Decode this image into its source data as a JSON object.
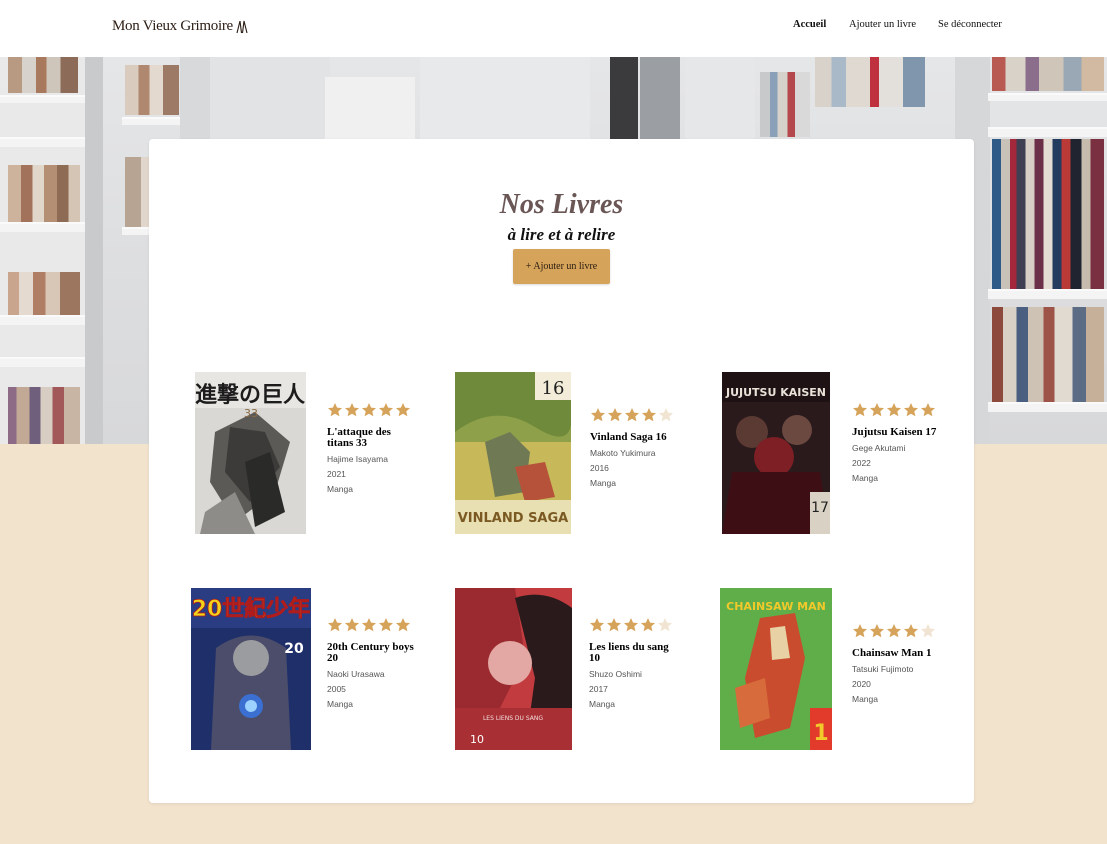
{
  "header": {
    "logo_text": "Mon Vieux Grimoire",
    "nav": {
      "home": "Accueil",
      "add_book": "Ajouter un livre",
      "logout": "Se déconnecter"
    }
  },
  "main": {
    "title": "Nos Livres",
    "subtitle": "à lire et à relire",
    "add_button": "+ Ajouter un livre"
  },
  "colors": {
    "accent": "#d6a35a",
    "star_filled": "#d6a35a",
    "star_empty": "#f1e4d2",
    "page_bg": "#f2e3cd",
    "title": "#6b5656"
  },
  "books": [
    {
      "title": "L'attaque des titans 33",
      "author": "Hajime Isayama",
      "year": "2021",
      "genre": "Manga",
      "rating": 5
    },
    {
      "title": "Vinland Saga 16",
      "author": "Makoto Yukimura",
      "year": "2016",
      "genre": "Manga",
      "rating": 4
    },
    {
      "title": "Jujutsu Kaisen 17",
      "author": "Gege Akutami",
      "year": "2022",
      "genre": "Manga",
      "rating": 5
    },
    {
      "title": "20th Century boys 20",
      "author": "Naoki Urasawa",
      "year": "2005",
      "genre": "Manga",
      "rating": 5
    },
    {
      "title": "Les liens du sang 10",
      "author": "Shuzo Oshimi",
      "year": "2017",
      "genre": "Manga",
      "rating": 4
    },
    {
      "title": "Chainsaw Man 1",
      "author": "Tatsuki Fujimoto",
      "year": "2020",
      "genre": "Manga",
      "rating": 4
    }
  ],
  "covers": [
    {
      "text": "進撃の巨人",
      "sub": "33"
    },
    {
      "text": "VINLAND SAGA",
      "sub": "16"
    },
    {
      "text": "JUJUTSU KAISEN",
      "sub": "17"
    },
    {
      "text": "20世紀少年",
      "sub": "20"
    },
    {
      "text": "LES LIENS DU SANG",
      "sub": "10"
    },
    {
      "text": "CHAINSAW MAN",
      "sub": "1"
    }
  ]
}
